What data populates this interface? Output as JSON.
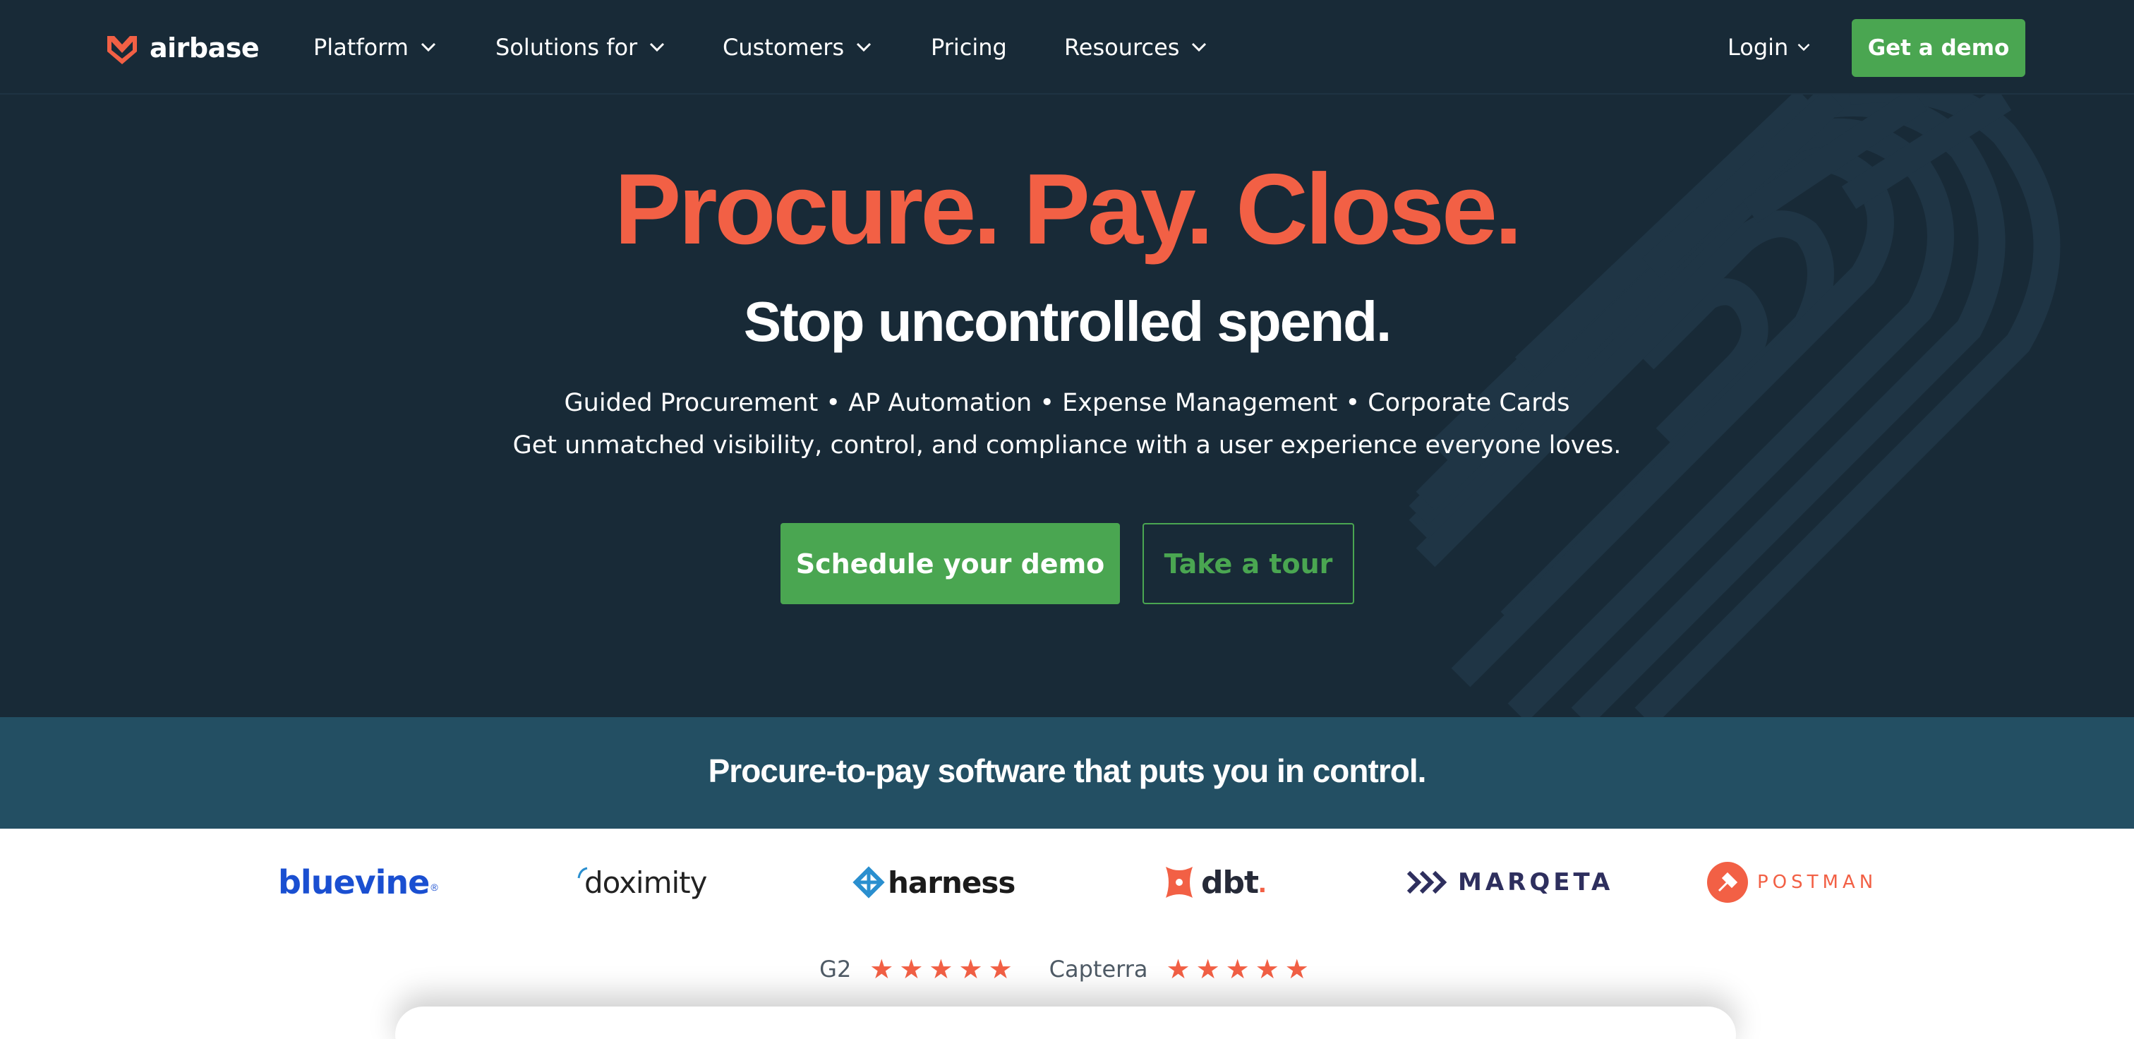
{
  "nav": {
    "logo_text": "airbase",
    "items": [
      {
        "label": "Platform",
        "dropdown": true
      },
      {
        "label": "Solutions for",
        "dropdown": true
      },
      {
        "label": "Customers",
        "dropdown": true
      },
      {
        "label": "Pricing",
        "dropdown": false
      },
      {
        "label": "Resources",
        "dropdown": true
      }
    ],
    "login_label": "Login",
    "demo_label": "Get a demo"
  },
  "hero": {
    "headline": "Procure. Pay. Close.",
    "subheadline": "Stop uncontrolled spend.",
    "features": "Guided Procurement • AP Automation • Expense Management • Corporate Cards",
    "tagline": "Get unmatched visibility, control, and compliance with a user experience everyone loves.",
    "primary_cta": "Schedule your demo",
    "secondary_cta": "Take a tour"
  },
  "band": {
    "text": "Procure-to-pay software that puts you in control."
  },
  "customers": {
    "logos": [
      {
        "name": "bluevine",
        "text": "bluevine"
      },
      {
        "name": "doximity",
        "text": "doximity"
      },
      {
        "name": "harness",
        "text": "harness"
      },
      {
        "name": "dbt",
        "text": "dbt"
      },
      {
        "name": "marqeta",
        "text": "MARQETA"
      },
      {
        "name": "postman",
        "text": "POSTMAN"
      }
    ]
  },
  "ratings": [
    {
      "source": "G2",
      "stars": 5
    },
    {
      "source": "Capterra",
      "stars": 5
    }
  ],
  "colors": {
    "hero_bg": "#182a37",
    "accent_orange": "#f26045",
    "accent_green": "#4aa651",
    "band_bg": "#234f63"
  }
}
